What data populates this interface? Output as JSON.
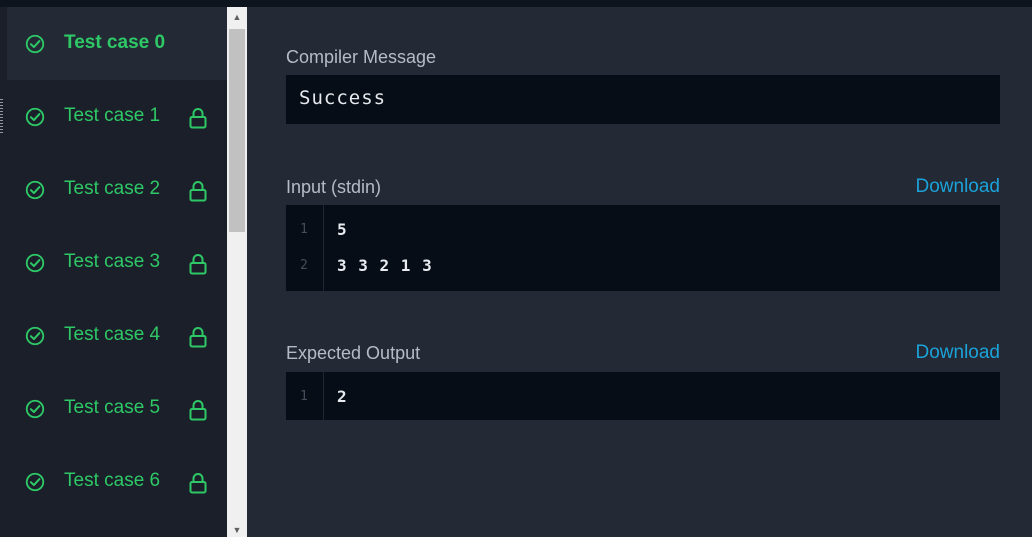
{
  "colors": {
    "accent_green": "#2ec866",
    "download_blue": "#1ba2d9",
    "panel_bg": "#232a35",
    "sidebar_bg": "#1a1f2a",
    "code_bg": "#070d17"
  },
  "sidebar": {
    "items": [
      {
        "label": "Test case 0",
        "active": true,
        "locked": false,
        "status_icon": "check-circle-icon"
      },
      {
        "label": "Test case 1",
        "active": false,
        "locked": true,
        "status_icon": "check-circle-icon"
      },
      {
        "label": "Test case 2",
        "active": false,
        "locked": true,
        "status_icon": "check-circle-icon"
      },
      {
        "label": "Test case 3",
        "active": false,
        "locked": true,
        "status_icon": "check-circle-icon"
      },
      {
        "label": "Test case 4",
        "active": false,
        "locked": true,
        "status_icon": "check-circle-icon"
      },
      {
        "label": "Test case 5",
        "active": false,
        "locked": true,
        "status_icon": "check-circle-icon"
      },
      {
        "label": "Test case 6",
        "active": false,
        "locked": true,
        "status_icon": "check-circle-icon"
      }
    ]
  },
  "main": {
    "compiler": {
      "label": "Compiler Message",
      "message": "Success"
    },
    "input": {
      "label": "Input (stdin)",
      "download_label": "Download",
      "lines": [
        {
          "num": "1",
          "text": "5"
        },
        {
          "num": "2",
          "text": "3 3 2 1 3"
        }
      ]
    },
    "expected": {
      "label": "Expected Output",
      "download_label": "Download",
      "lines": [
        {
          "num": "1",
          "text": "2"
        }
      ]
    }
  }
}
